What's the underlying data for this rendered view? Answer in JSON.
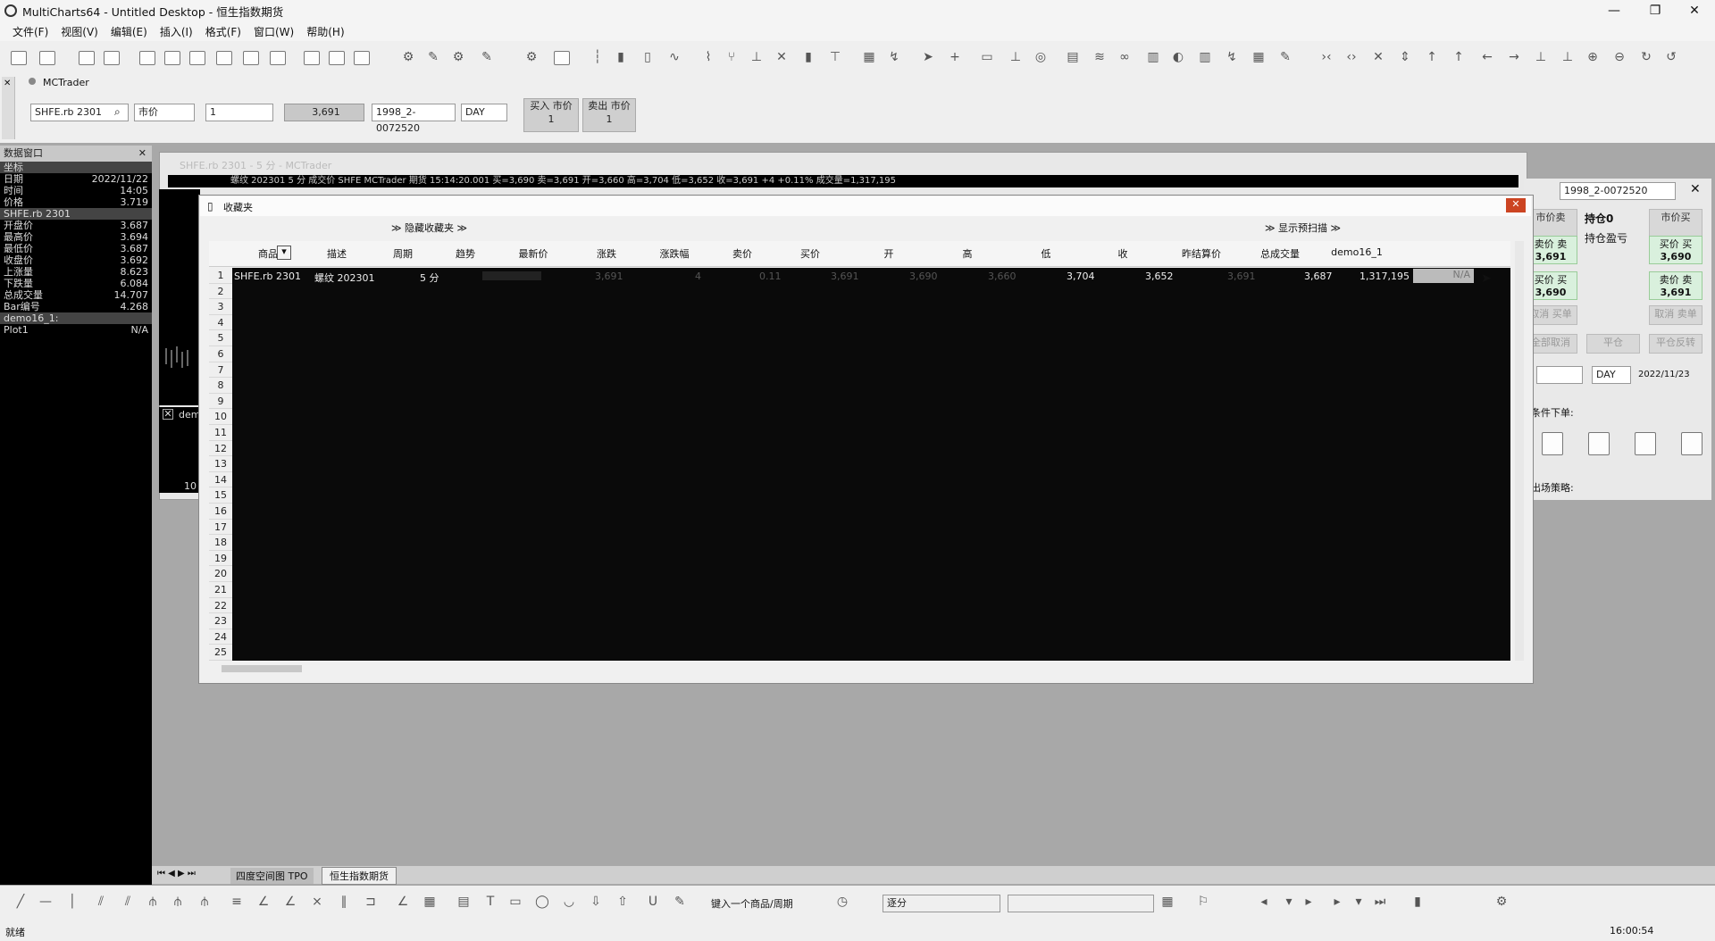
{
  "window": {
    "title": "MultiCharts64 - Untitled Desktop - 恒生指数期货",
    "controls": [
      "—",
      "❐",
      "✕"
    ]
  },
  "menu": [
    "文件(F)",
    "视图(V)",
    "编辑(E)",
    "插入(I)",
    "格式(F)",
    "窗口(W)",
    "帮助(H)"
  ],
  "trade_strip": {
    "broker": "MCTrader",
    "symbol": "SHFE.rb 2301",
    "order_type": "市价",
    "quantity": "1",
    "price": "3,691",
    "account": "1998_2-0072520",
    "tif": "DAY",
    "buy": {
      "label": "买入 市价",
      "qty": "1"
    },
    "sell": {
      "label": "卖出 市价",
      "qty": "1"
    }
  },
  "data_panel": {
    "title": "数据窗口",
    "rows": [
      {
        "k": "坐标",
        "v": "",
        "sec": true
      },
      {
        "k": "日期",
        "v": "2022/11/22"
      },
      {
        "k": "时间",
        "v": "14:05"
      },
      {
        "k": "价格",
        "v": "3.719"
      },
      {
        "k": "SHFE.rb 2301",
        "v": "",
        "sec": true
      },
      {
        "k": "开盘价",
        "v": "3.687"
      },
      {
        "k": "最高价",
        "v": "3.694"
      },
      {
        "k": "最低价",
        "v": "3.687"
      },
      {
        "k": "收盘价",
        "v": "3.692"
      },
      {
        "k": "上涨量",
        "v": "8.623"
      },
      {
        "k": "下跌量",
        "v": "6.084"
      },
      {
        "k": "总成交量",
        "v": "14.707"
      },
      {
        "k": "Bar编号",
        "v": "4.268"
      },
      {
        "k": "demo16_1:",
        "v": "",
        "sec": true
      },
      {
        "k": "Plot1",
        "v": "N/A"
      }
    ]
  },
  "chart": {
    "title": "SHFE.rb 2301 - 5 分 - MCTrader",
    "infobar": "螺纹 202301 5 分  成交价 SHFE MCTrader 期货 15:14:20.001 买=3,690 卖=3,691 开=3,660 高=3,704 低=3,652 收=3,691 +4 +0.11% 成交量=1,317,195",
    "left_value": "10",
    "indicator_tab": "dem"
  },
  "order_panel": {
    "account": "1998_2-0072520",
    "market_sell": "市价卖",
    "position": "持仓0",
    "position_pl": "持仓盈亏",
    "market_buy": "市价买",
    "bid_label": "卖价 卖",
    "bid_value": "3,691",
    "ask_label": "买价 买",
    "ask_value": "3,690",
    "bid2_value": "3,690",
    "ask2_value": "3,691",
    "cancel_buy": "取消 买单",
    "cancel_sell": "取消 卖单",
    "cancel_all": "全部取消",
    "flatten": "平仓",
    "reverse": "平仓反转",
    "tif": "DAY",
    "date": "2022/11/23",
    "conditional": "条件下单:",
    "exit_strategy": "出场策略:"
  },
  "favorites": {
    "title": "收藏夹",
    "hide_label": "隐藏收藏夹",
    "scan_label": "显示预扫描",
    "columns": [
      "商品",
      "描述",
      "周期",
      "趋势",
      "最新价",
      "涨跌",
      "涨跌幅",
      "卖价",
      "买价",
      "开",
      "高",
      "低",
      "收",
      "昨结算价",
      "总成交量",
      "demo16_1"
    ],
    "row": {
      "num": "1",
      "symbol": "SHFE.rb 2301",
      "desc": "螺纹 202301",
      "period": "5 分",
      "last": "3,691",
      "change": "4",
      "pct": "0.11",
      "ask": "3,691",
      "bid": "3,690",
      "open": "3,660",
      "high": "3,704",
      "low": "3,652",
      "close": "3,691",
      "prev_settle": "3,687",
      "volume": "1,317,195",
      "demo": "N/A"
    },
    "row_numbers": [
      "1",
      "2",
      "3",
      "4",
      "5",
      "6",
      "7",
      "8",
      "9",
      "10",
      "11",
      "12",
      "13",
      "14",
      "15",
      "16",
      "17",
      "18",
      "19",
      "20",
      "21",
      "22",
      "23",
      "24",
      "25"
    ]
  },
  "sheet_tabs": [
    "四度空间图 TPO",
    "恒生指数期货"
  ],
  "bottom_toolbar": {
    "symbol_input_placeholder": "键入一个商品/周期",
    "interval": "逐分"
  },
  "status": {
    "left": "就绪",
    "time": "16:00:54"
  }
}
